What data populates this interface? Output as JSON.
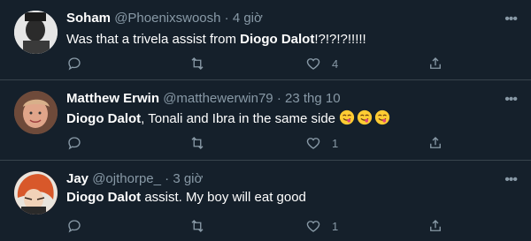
{
  "tweets": [
    {
      "name": "Soham",
      "handle": "@Phoenixswoosh",
      "sep": "·",
      "time": "4 giờ",
      "text_bold": "",
      "text_pre": "Was that a trivela assist from ",
      "text_bold2": "Diogo Dalot",
      "text_post": "!?!?!?!!!!!",
      "likes": "4",
      "avatar": "user-avatar"
    },
    {
      "name": "Matthew Erwin",
      "handle": "@matthewerwin79",
      "sep": "·",
      "time": "23 thg 10",
      "text_bold": "Diogo Dalot",
      "text_post": ", Tonali and Ibra in the same side ",
      "likes": "1",
      "emoji_count": 3,
      "emoji": "smiling-face-with-tongue"
    },
    {
      "name": "Jay",
      "handle": "@ojthorpe_",
      "sep": "·",
      "time": "3 giờ",
      "text_bold": "Diogo Dalot",
      "text_post": " assist. My boy will eat good",
      "likes": "1"
    }
  ],
  "more_label": "•••",
  "colors": {
    "background": "#15202b",
    "divider": "#38444d",
    "muted": "#8899a6",
    "text": "#ffffff"
  },
  "icons": [
    "reply-icon",
    "retweet-icon",
    "like-icon",
    "share-icon",
    "more-icon"
  ]
}
